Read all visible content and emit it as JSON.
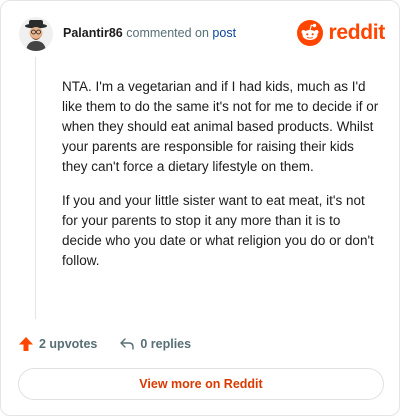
{
  "comment": {
    "username": "Palantir86",
    "action_text": "commented on",
    "post_link_text": "post",
    "brand": "reddit",
    "paragraphs": [
      "NTA. I'm a vegetarian and if I had kids, much as I'd like them to do the same it's not for me to decide if or when they should eat animal based products. Whilst your parents are responsible for raising their kids they can't force a dietary lifestyle on them.",
      "If you and your little sister want to eat meat, it's not for your parents to stop it any more than it is to decide who you date or what religion you do or don't follow."
    ],
    "upvotes_label": "2 upvotes",
    "replies_label": "0 replies",
    "view_more_label": "View more on Reddit"
  },
  "colors": {
    "brand_orange": "#ff4500",
    "upvote_red": "#ff4500",
    "link_blue": "#0a449b",
    "muted_text": "#576f76"
  },
  "icons": [
    "avatar",
    "reddit-logo-icon",
    "upvote-arrow-icon",
    "reply-arrow-icon"
  ]
}
